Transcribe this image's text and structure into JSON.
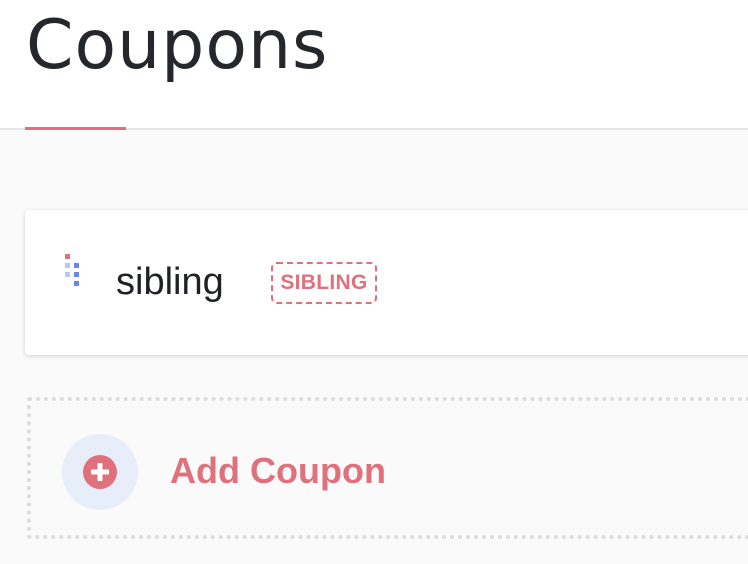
{
  "header": {
    "title": "Coupons"
  },
  "coupons": [
    {
      "name": "sibling",
      "code": "SIBLING"
    }
  ],
  "add_coupon": {
    "label": "Add Coupon",
    "icon": "plus-circle-icon"
  },
  "colors": {
    "accent": "#e0707c",
    "title_text": "#24272c",
    "handle_blue": "#6a86e6",
    "icon_bg": "#e7eefa"
  }
}
